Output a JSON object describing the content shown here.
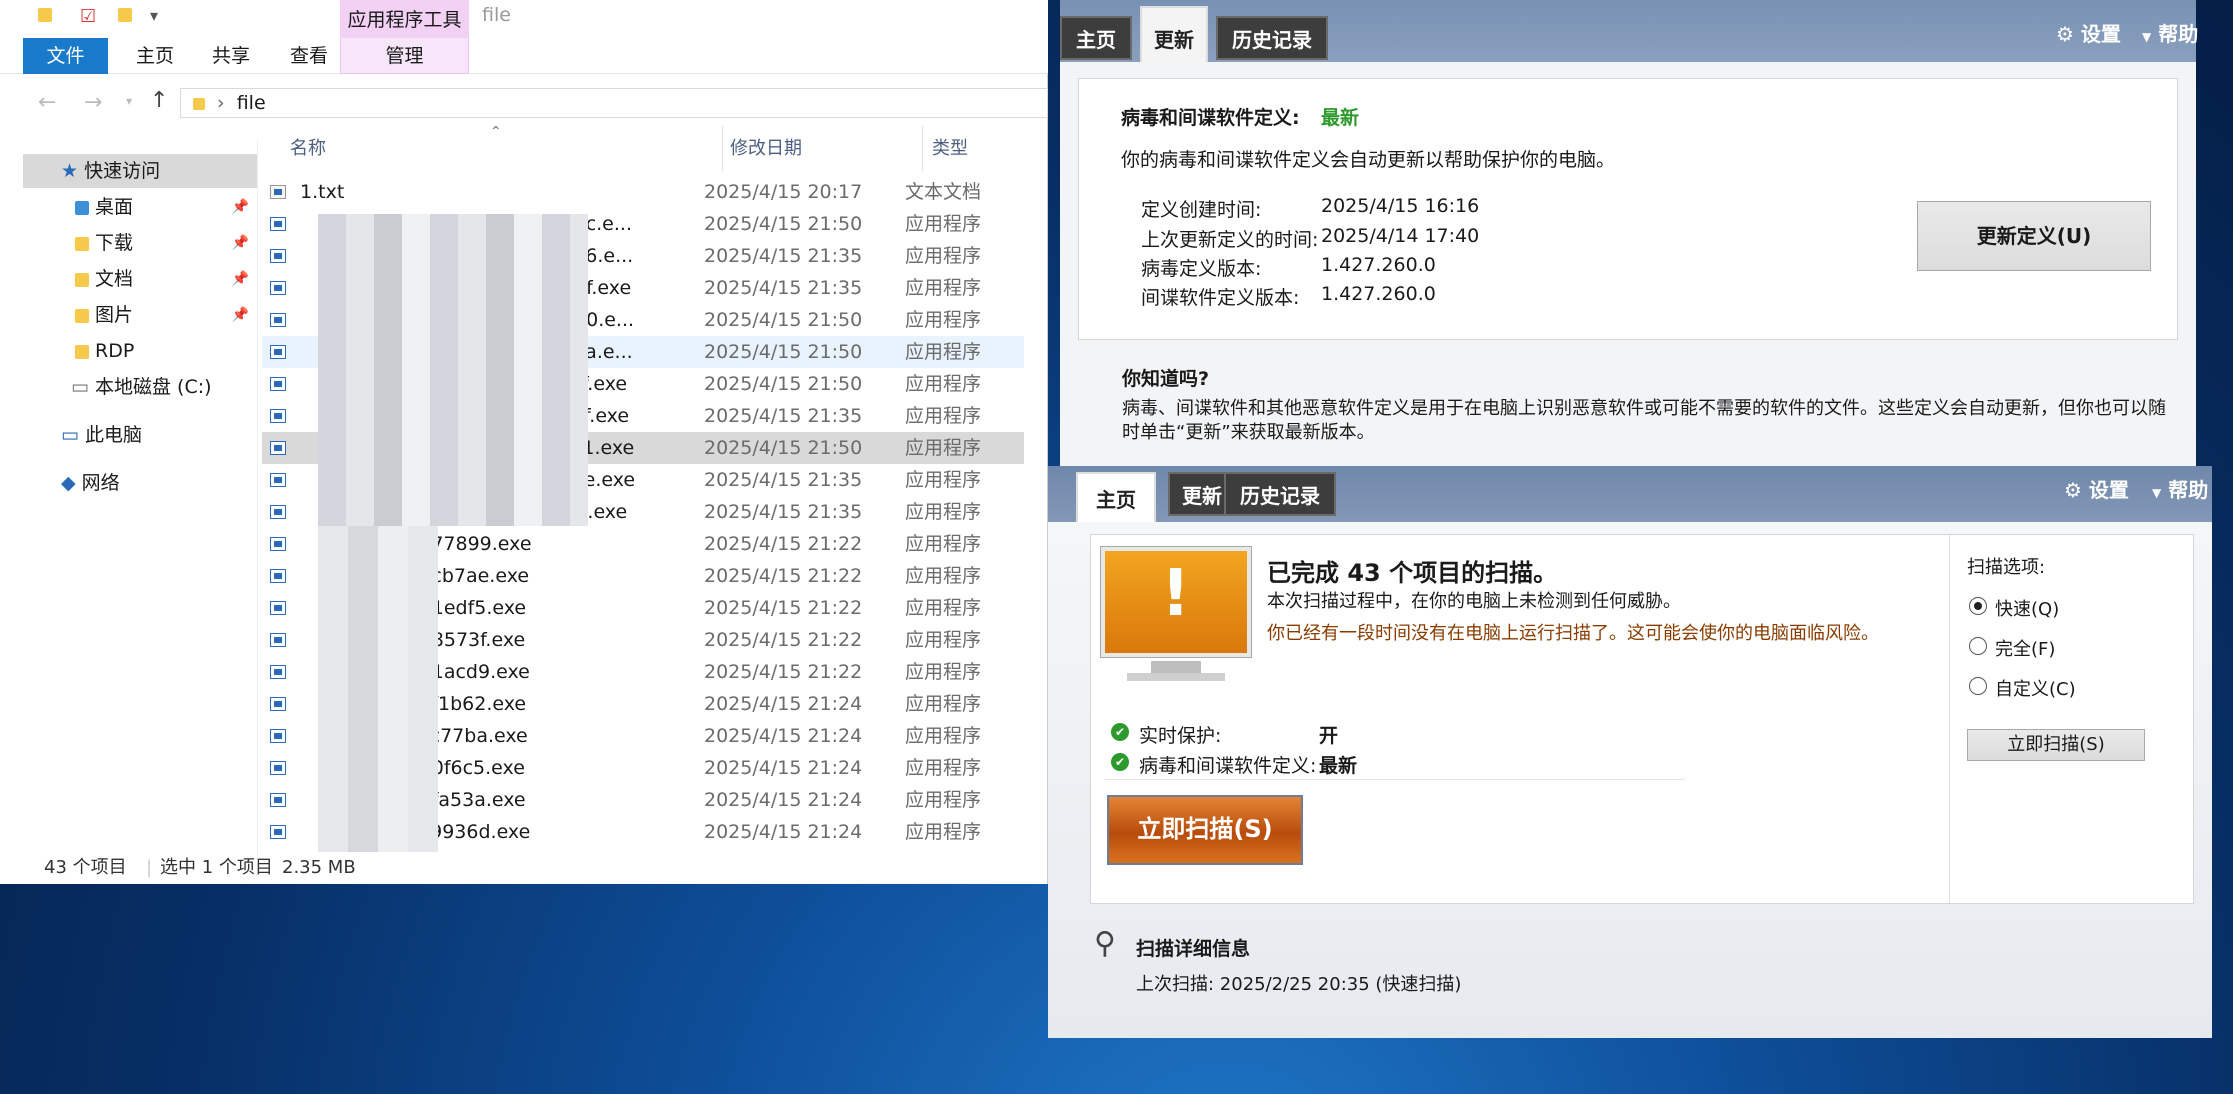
{
  "explorer": {
    "context_tab": "应用程序工具",
    "context_sub": "管理",
    "title": "file",
    "ribbon_tabs": [
      "文件",
      "主页",
      "共享",
      "查看"
    ],
    "address": "file",
    "nav": {
      "quick_access": "快速访问",
      "desktop": "桌面",
      "downloads": "下载",
      "documents": "文档",
      "pictures": "图片",
      "rdp": "RDP",
      "local_disk": "本地磁盘 (C:)",
      "this_pc": "此电脑",
      "network": "网络"
    },
    "columns": {
      "name": "名称",
      "modified": "修改日期",
      "type": "类型"
    },
    "rows": [
      {
        "name": "1.txt",
        "date": "2025/4/15 20:17",
        "type": "文本文档"
      },
      {
        "name": "_0e36d36c.e...",
        "date": "2025/4/15 21:50",
        "type": "应用程序"
      },
      {
        "name": "_14a81de6.e...",
        "date": "2025/4/15 21:35",
        "type": "应用程序"
      },
      {
        "name": "_401d124f.exe",
        "date": "2025/4/15 21:35",
        "type": "应用程序"
      },
      {
        "name": "_90834140.e...",
        "date": "2025/4/15 21:50",
        "type": "应用程序"
      },
      {
        "name": "_a5ad7d6a.e...",
        "date": "2025/4/15 21:50",
        "type": "应用程序"
      },
      {
        "name": "_acc3e57f.exe",
        "date": "2025/4/15 21:50",
        "type": "应用程序"
      },
      {
        "name": "_bc75ad0f.exe",
        "date": "2025/4/15 21:35",
        "type": "应用程序"
      },
      {
        "name": "_c25d5ce1.exe",
        "date": "2025/4/15 21:50",
        "type": "应用程序"
      },
      {
        "name": "_e0e6c8be.exe",
        "date": "2025/4/15 21:35",
        "type": "应用程序"
      },
      {
        "name": "_f8218f34.exe",
        "date": "2025/4/15 21:35",
        "type": "应用程序"
      },
      {
        "name": "_6a577899.exe",
        "date": "2025/4/15 21:22",
        "type": "应用程序"
      },
      {
        "name": "_74ecb7ae.exe",
        "date": "2025/4/15 21:22",
        "type": "应用程序"
      },
      {
        "name": "_2231edf5.exe",
        "date": "2025/4/15 21:22",
        "type": "应用程序"
      },
      {
        "name": "_3528573f.exe",
        "date": "2025/4/15 21:22",
        "type": "应用程序"
      },
      {
        "name": "_b431acd9.exe",
        "date": "2025/4/15 21:22",
        "type": "应用程序"
      },
      {
        "name": "_62af1b62.exe",
        "date": "2025/4/15 21:24",
        "type": "应用程序"
      },
      {
        "name": "_acbc77ba.exe",
        "date": "2025/4/15 21:24",
        "type": "应用程序"
      },
      {
        "name": "_b830f6c5.exe",
        "date": "2025/4/15 21:24",
        "type": "应用程序"
      },
      {
        "name": "_bd3fa53a.exe",
        "date": "2025/4/15 21:24",
        "type": "应用程序"
      },
      {
        "name": "_c309936d.exe",
        "date": "2025/4/15 21:24",
        "type": "应用程序"
      }
    ],
    "status": {
      "count": "43 个项目",
      "selected": "选中 1 个项目",
      "size": "2.35 MB"
    }
  },
  "defender_update": {
    "tabs": [
      "主页",
      "更新",
      "历史记录"
    ],
    "settings": "设置",
    "help": "帮助",
    "def_label": "病毒和间谍软件定义:",
    "def_status": "最新",
    "desc": "你的病毒和间谍软件定义会自动更新以帮助保护你的电脑。",
    "fields": [
      {
        "k": "定义创建时间:",
        "v": "2025/4/15 16:16"
      },
      {
        "k": "上次更新定义的时间:",
        "v": "2025/4/14 17:40"
      },
      {
        "k": "病毒定义版本:",
        "v": "1.427.260.0"
      },
      {
        "k": "间谍软件定义版本:",
        "v": "1.427.260.0"
      }
    ],
    "update_button": "更新定义(U)",
    "tip_title": "你知道吗?",
    "tip_line1": "病毒、间谍软件和其他恶意软件定义是用于在电脑上识别恶意软件或可能不需要的软件的文件。这些定义会自动更新，但你也可以随",
    "tip_line2": "时单击“更新”来获取最新版本。"
  },
  "defender_home": {
    "tabs": [
      "主页",
      "更新",
      "历史记录"
    ],
    "settings": "设置",
    "help": "帮助",
    "headline": "已完成 43 个项目的扫描。",
    "sub1": "本次扫描过程中，在你的电脑上未检测到任何威胁。",
    "sub2": "你已经有一段时间没有在电脑上运行扫描了。这可能会使你的电脑面临风险。",
    "realtime_label": "实时保护:",
    "realtime_value": "开",
    "def_label": "病毒和间谍软件定义:",
    "def_value": "最新",
    "scan_button": "立即扫描(S)",
    "options_title": "扫描选项:",
    "options": [
      "快速(Q)",
      "完全(F)",
      "自定义(C)"
    ],
    "options_button": "立即扫描(S)",
    "details_title": "扫描详细信息",
    "last_scan": "上次扫描: 2025/2/25 20:35 (快速扫描)"
  },
  "colors": {
    "accent": "#1979ca",
    "ok_green": "#2e9a2e",
    "warn_brown": "#8a3c00",
    "scan_orange": "#d2600f"
  }
}
